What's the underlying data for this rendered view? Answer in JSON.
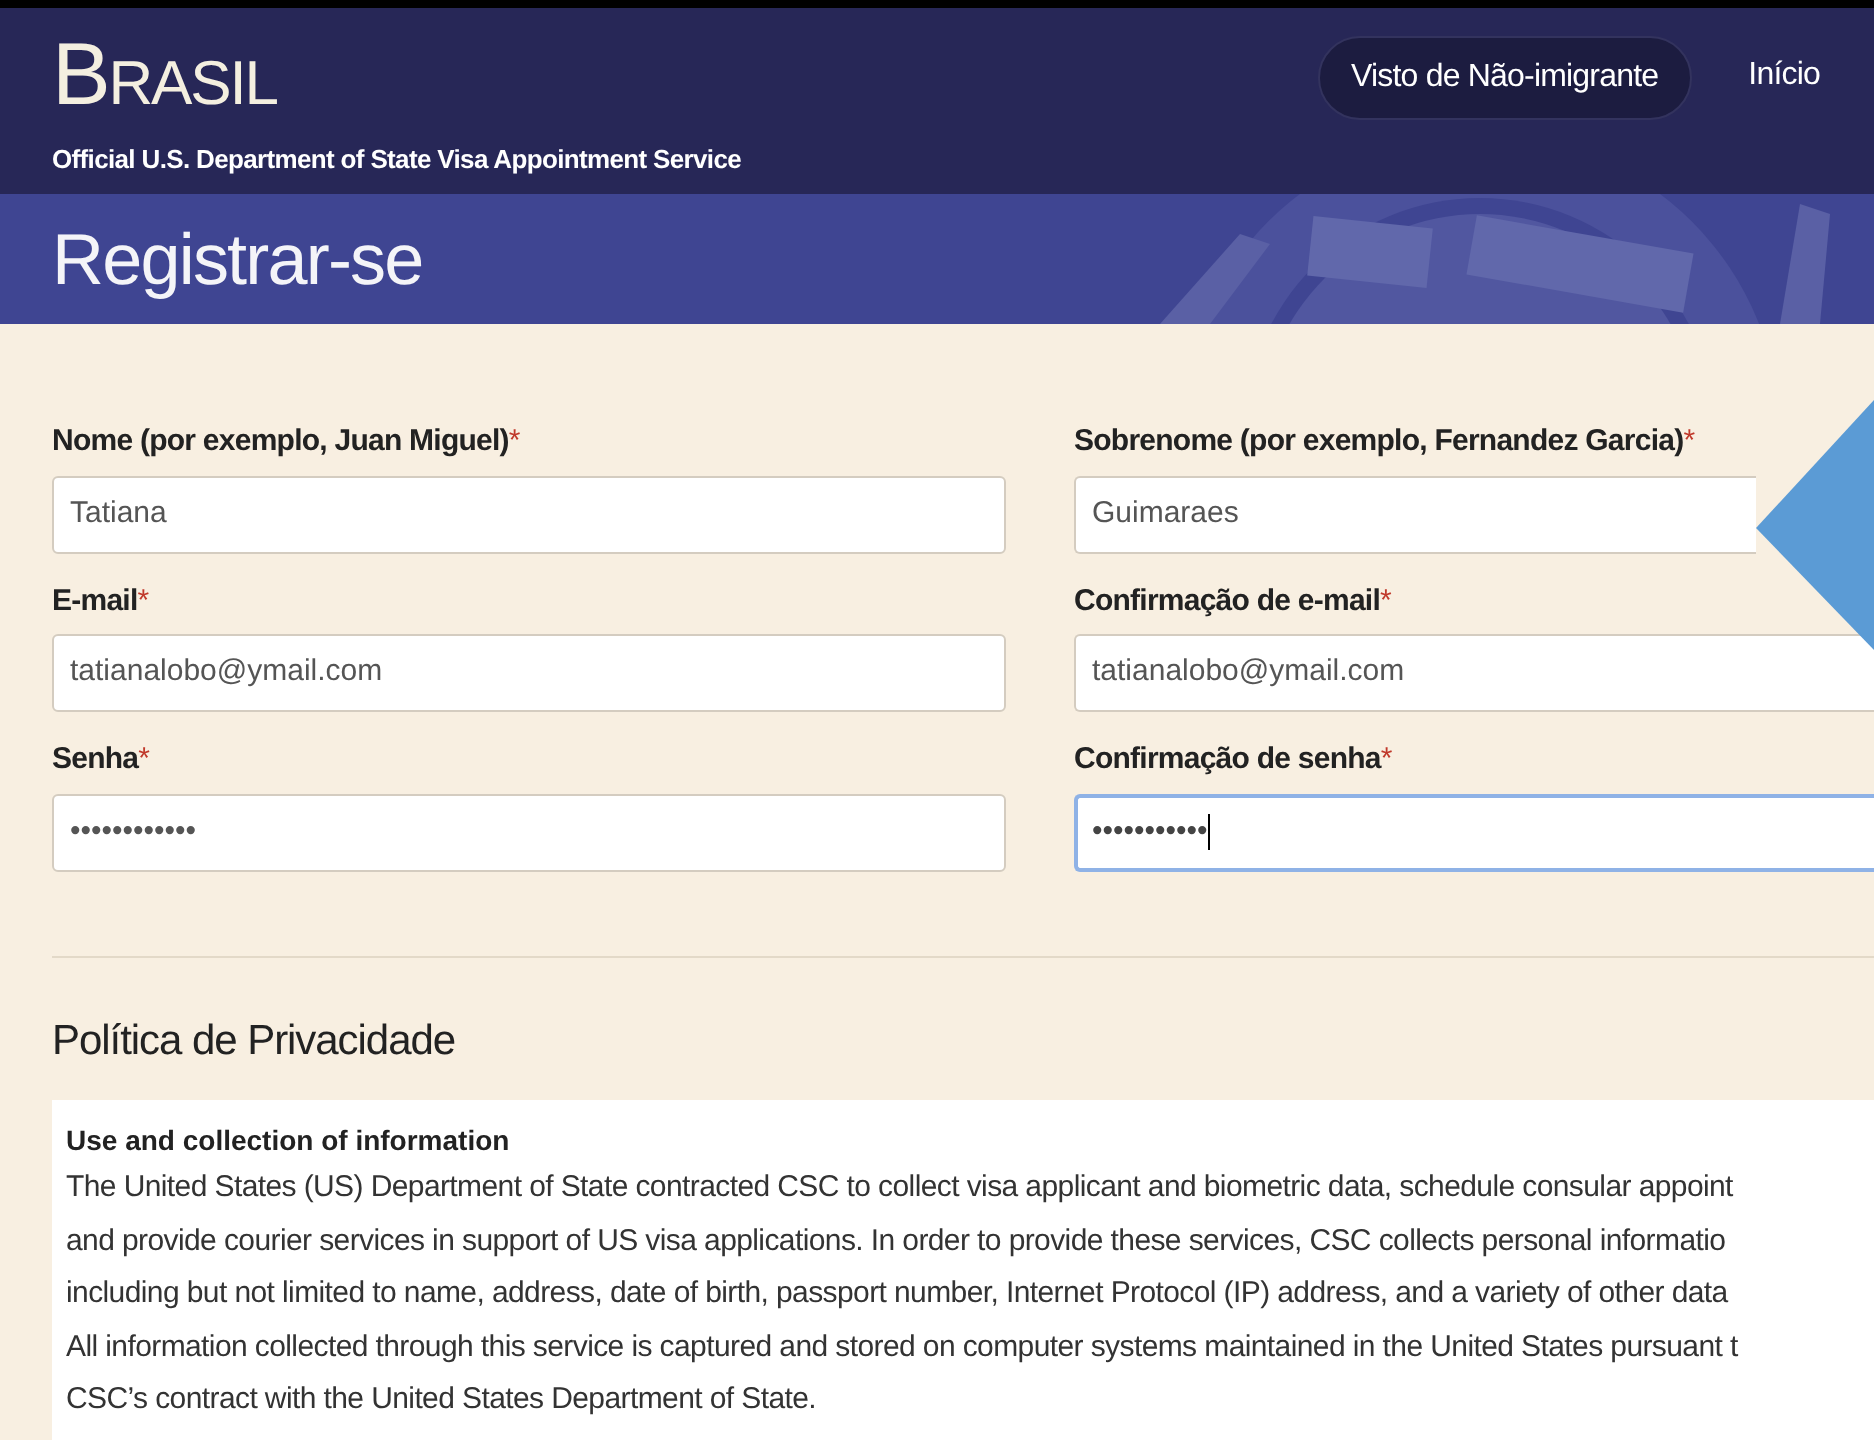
{
  "header": {
    "brand": "Brasil",
    "subtitle": "Official U.S. Department of State Visa Appointment Service",
    "nav": [
      {
        "label": "Visto de Não-imigrante",
        "selected": true
      },
      {
        "label": "Início",
        "selected": false
      }
    ]
  },
  "banner": {
    "title": "Registrar-se"
  },
  "form": {
    "fields": [
      {
        "label": "Nome (por exemplo, Juan Miguel)",
        "required": true,
        "value": "Tatiana",
        "focused": false
      },
      {
        "label": "Sobrenome (por exemplo, Fernandez Garcia)",
        "required": true,
        "value": "Guimaraes",
        "focused": false
      },
      {
        "label": "E-mail",
        "required": true,
        "value": "tatianalobo@ymail.com",
        "focused": false
      },
      {
        "label": "Confirmação de e-mail",
        "required": true,
        "value": "tatianalobo@ymail.com",
        "focused": false
      },
      {
        "label": "Senha",
        "required": true,
        "value": "••••••••••••",
        "focused": false
      },
      {
        "label": "Confirmação de senha",
        "required": true,
        "value": "•••••••••••",
        "focused": true
      }
    ],
    "required_mark": "*"
  },
  "privacy": {
    "title": "Política de Privacidade",
    "heading": "Use and collection of information",
    "lines": [
      "The United States (US) Department of State contracted CSC to collect visa applicant and biometric data, schedule consular appoint",
      "and provide courier services in support of US visa applications. In order to provide these services, CSC collects personal informatio",
      "including but not limited to name, address, date of birth, passport number, Internet Protocol (IP) address, and a variety of other data",
      "All information collected through this service is captured and stored on computer systems maintained in the United States pursuant t",
      "CSC’s contract with the United States Department of State."
    ]
  }
}
